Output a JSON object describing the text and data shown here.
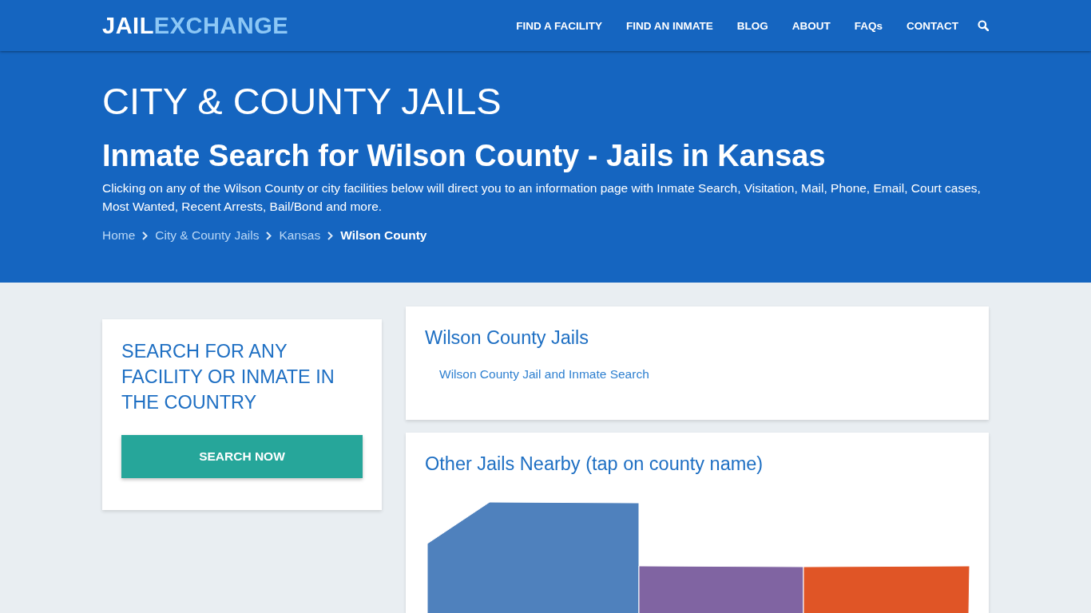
{
  "header": {
    "logo": {
      "part_1": "JAIL",
      "part_2": "EXCHANGE"
    },
    "nav": [
      "FIND A FACILITY",
      "FIND AN INMATE",
      "BLOG",
      "ABOUT",
      "FAQs",
      "CONTACT"
    ]
  },
  "hero": {
    "title": "CITY & COUNTY JAILS",
    "subtitle": "Inmate Search for Wilson County - Jails in Kansas",
    "description": "Clicking on any of the Wilson County or city facilities below will direct you to an information page with Inmate Search, Visitation, Mail, Phone, Email, Court cases, Most Wanted, Recent Arrests, Bail/Bond and more.",
    "breadcrumb": [
      {
        "label": "Home",
        "current": false
      },
      {
        "label": "City & County Jails",
        "current": false
      },
      {
        "label": "Kansas",
        "current": false
      },
      {
        "label": "Wilson County",
        "current": true
      }
    ]
  },
  "search_card": {
    "heading": "SEARCH FOR ANY FACILITY OR INMATE IN THE COUNTRY",
    "button": "SEARCH NOW"
  },
  "jails_card": {
    "heading": "Wilson County Jails",
    "links": [
      "Wilson County Jail and Inmate Search"
    ]
  },
  "nearby_card": {
    "heading": "Other Jails Nearby (tap on county name)",
    "counties": [
      {
        "color": "#4f81bd"
      },
      {
        "color": "#8064a2"
      },
      {
        "color": "#e05526"
      }
    ]
  }
}
